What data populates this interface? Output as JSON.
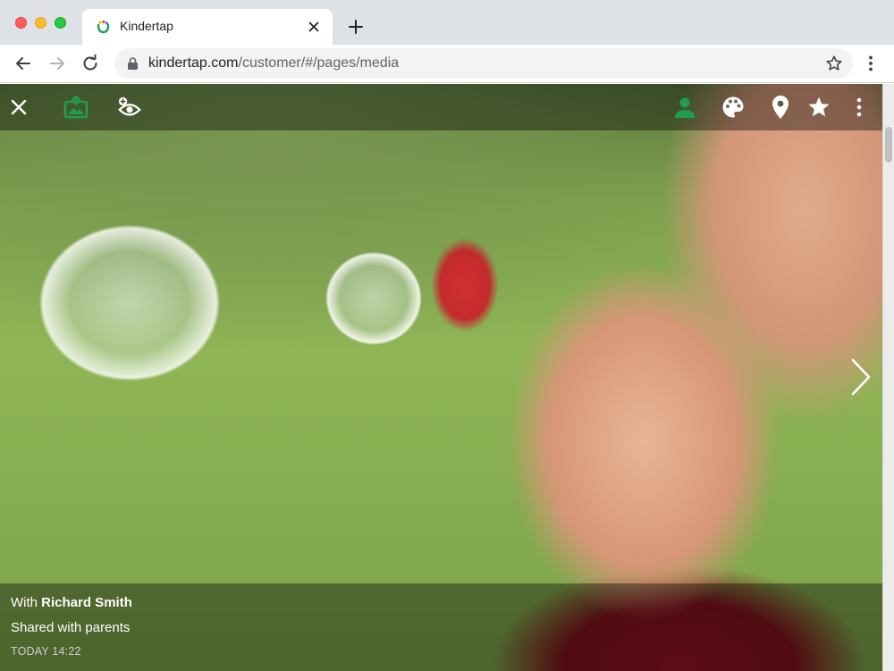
{
  "browser": {
    "tab": {
      "title": "Kindertap"
    },
    "address": {
      "host": "kindertap.com",
      "path": "/customer/#/pages/media"
    }
  },
  "viewer": {
    "top_bar": {
      "left_icons": [
        "close-icon",
        "photo-upload-icon",
        "visibility-add-icon"
      ],
      "right_icons": [
        "person-icon",
        "palette-icon",
        "location-pin-icon",
        "star-icon",
        "more-vert-icon"
      ]
    },
    "caption": {
      "with_prefix": "With",
      "with_name": "Richard Smith",
      "shared": "Shared with parents",
      "timestamp": "TODAY 14:22"
    }
  },
  "colors": {
    "brand_green": "#1f9d4d",
    "overlay": "rgba(0,0,0,0.38)",
    "tab_strip": "#dee1e6"
  }
}
